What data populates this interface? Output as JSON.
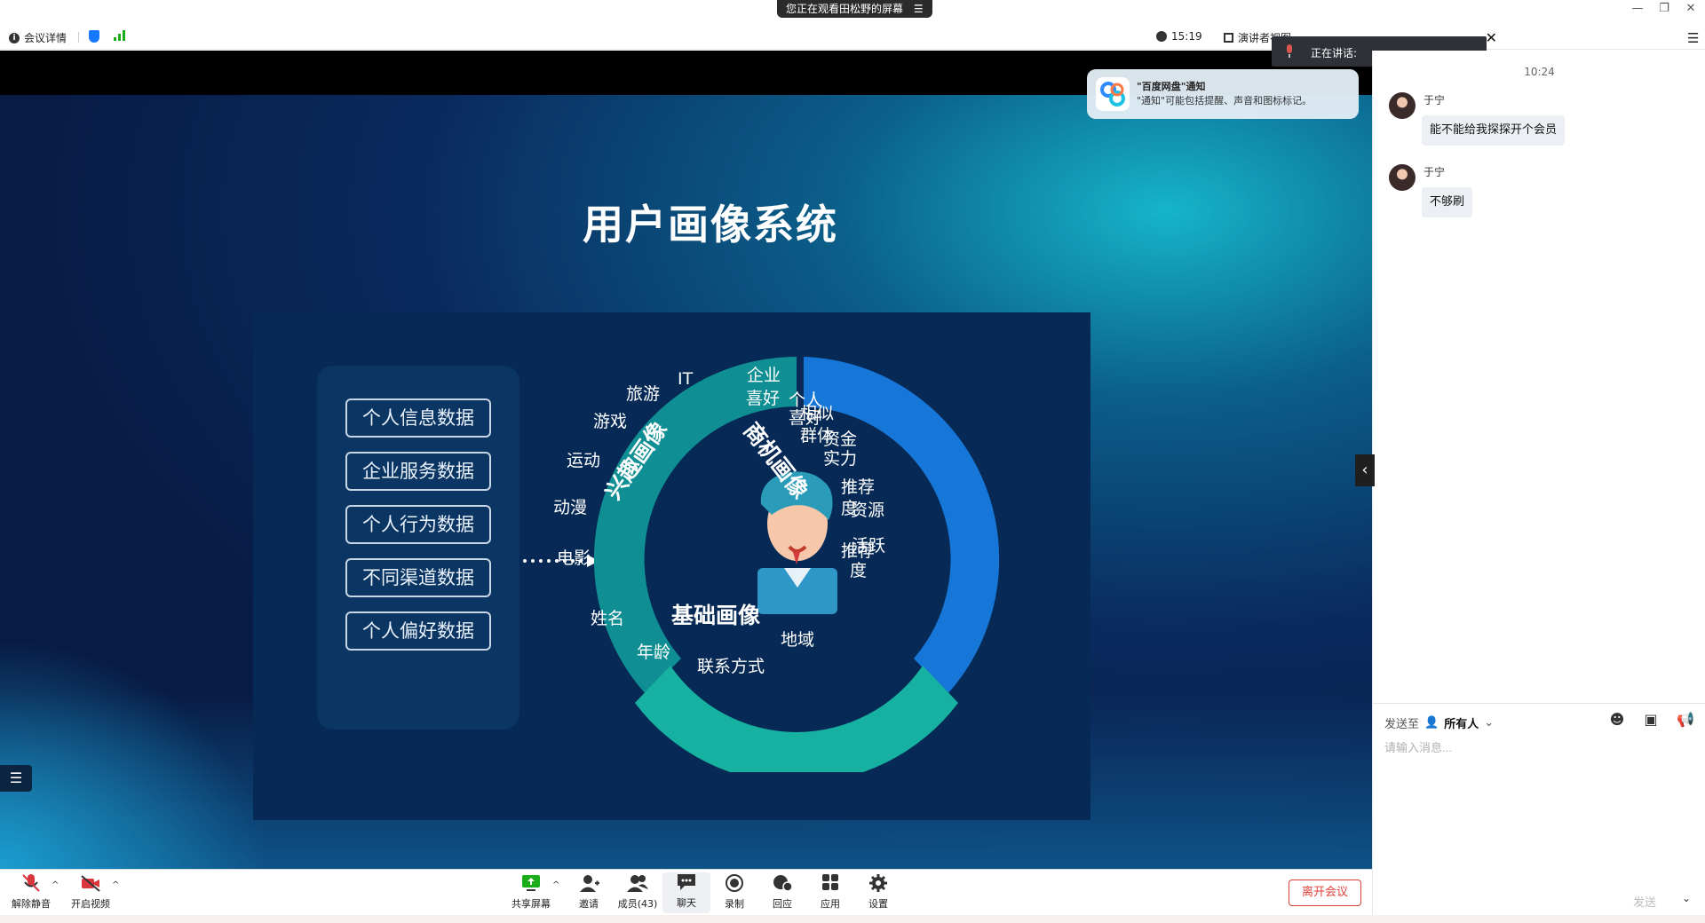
{
  "titlebar": {
    "viewing_banner": "您正在观看田松野的屏幕",
    "minimize": "—",
    "restore": "❐",
    "close": "✕"
  },
  "infobar": {
    "meeting_details": "会议详情",
    "time": "15:19",
    "presenter_view": "演讲者视图",
    "chat_label": "聊天"
  },
  "speaking": {
    "label": "正在讲话:"
  },
  "notification": {
    "title": "\"百度网盘\"通知",
    "text": "\"通知\"可能包括提醒、声音和图标标记。"
  },
  "slide": {
    "title": "用户画像系统",
    "data_boxes": [
      "个人信息数据",
      "企业服务数据",
      "个人行为数据",
      "不同渠道数据",
      "个人偏好数据"
    ],
    "interest_label": "兴趣画像",
    "business_label": "商机画像",
    "basic_label": "基础画像",
    "interest_items": [
      "IT",
      "旅游",
      "游戏",
      "运动",
      "动漫",
      "电影"
    ],
    "business_items": [
      "企业",
      "喜好",
      "个人",
      "喜好",
      "相似",
      "群体",
      "资金",
      "实力",
      "推荐",
      "度",
      "资源",
      "活跃",
      "推荐",
      "度"
    ],
    "basic_items": [
      "姓名",
      "年龄",
      "联系方式",
      "地域"
    ],
    "colors": {
      "interest": "#0f8f93",
      "business": "#1677d8",
      "basic": "#16b1a0"
    }
  },
  "chat": {
    "time": "10:24",
    "messages": [
      {
        "sender": "于宁",
        "text": "能不能给我探探开个会员"
      },
      {
        "sender": "于宁",
        "text": "不够刷"
      }
    ],
    "send_to_label": "发送至",
    "send_to_target": "所有人",
    "input_placeholder": "请输入消息...",
    "send_label": "发送"
  },
  "toolbar": {
    "unmute": "解除静音",
    "start_video": "开启视频",
    "share_screen": "共享屏幕",
    "invite": "邀请",
    "members": "成员(43)",
    "chat": "聊天",
    "record": "录制",
    "reactions": "回应",
    "apps": "应用",
    "settings": "设置",
    "leave": "离开会议"
  }
}
